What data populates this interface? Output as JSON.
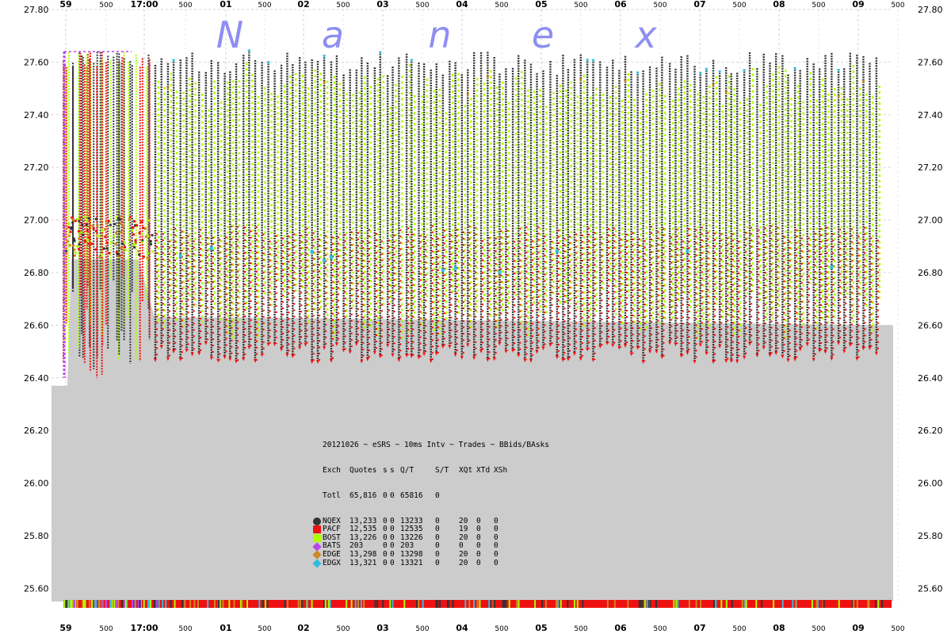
{
  "brand_letters": [
    "N",
    "a",
    "n",
    "e",
    "x"
  ],
  "chart_data": {
    "type": "scatter",
    "title": "20121026 ~ eSRS ~ 10ms Intv ~ Trades ~ BBids/BAsks",
    "ylim": [
      25.55,
      27.8
    ],
    "y_ticks": [
      "27.80",
      "27.60",
      "27.40",
      "27.20",
      "27.00",
      "26.80",
      "26.60",
      "26.40",
      "26.20",
      "26.00",
      "25.80",
      "25.60"
    ],
    "x_major_ticks": [
      "59",
      "17:00",
      "01",
      "02",
      "03",
      "04",
      "05",
      "06",
      "07",
      "08",
      "09"
    ],
    "x_minor_tick_label": "500",
    "grid": true,
    "colors": {
      "NQEX": "#333333",
      "PACF": "#ee1111",
      "BOST": "#aaff00",
      "BATS": "#bb44ee",
      "EDGE": "#cc8822",
      "EDGX": "#33bbdd",
      "area": "#cccccc"
    },
    "legend": {
      "title": "20121026 ~ eSRS ~ 10ms Intv ~ Trades ~ BBids/BAsks",
      "header": [
        "Exch",
        "Quotes",
        "s",
        "s",
        "Q/T",
        "S/T",
        "XQt",
        "XTd",
        "XSh"
      ],
      "total_row": [
        "Totl",
        "65,816",
        "0",
        "0",
        "65816",
        "0",
        "",
        "",
        ""
      ],
      "rows": [
        {
          "exch": "NQEX",
          "quotes": "13,233",
          "s1": "0",
          "s2": "0",
          "qt": "13233",
          "st": "0",
          "xqt": "20",
          "xtd": "0",
          "xsh": "0",
          "color": "#333333"
        },
        {
          "exch": "PACF",
          "quotes": "12,535",
          "s1": "0",
          "s2": "0",
          "qt": "12535",
          "st": "0",
          "xqt": "19",
          "xtd": "0",
          "xsh": "0",
          "color": "#ee1111"
        },
        {
          "exch": "BOST",
          "quotes": "13,226",
          "s1": "0",
          "s2": "0",
          "qt": "13226",
          "st": "0",
          "xqt": "20",
          "xtd": "0",
          "xsh": "0",
          "color": "#aaff00"
        },
        {
          "exch": "BATS",
          "quotes": "203",
          "s1": "0",
          "s2": "0",
          "qt": "203",
          "st": "0",
          "xqt": "0",
          "xtd": "0",
          "xsh": "0",
          "color": "#bb44ee"
        },
        {
          "exch": "EDGE",
          "quotes": "13,298",
          "s1": "0",
          "s2": "0",
          "qt": "13298",
          "st": "0",
          "xqt": "20",
          "xtd": "0",
          "xsh": "0",
          "color": "#cc8822"
        },
        {
          "exch": "EDGX",
          "quotes": "13,321",
          "s1": "0",
          "s2": "0",
          "qt": "13321",
          "st": "0",
          "xqt": "20",
          "xtd": "0",
          "xsh": "0",
          "color": "#33bbdd"
        }
      ]
    },
    "oscillation": {
      "cycle_count": 58,
      "top_ask": 27.64,
      "bottom_bid": 26.46,
      "series_visible": [
        "NQEX",
        "PACF",
        "BOST",
        "BATS",
        "EDGE",
        "EDGX"
      ]
    },
    "background_area": {
      "x_frac_start": 0.0,
      "x_frac_end": 1.0,
      "y_values": [
        26.37,
        26.37,
        26.85,
        26.85,
        26.63,
        26.63,
        26.6
      ]
    }
  }
}
